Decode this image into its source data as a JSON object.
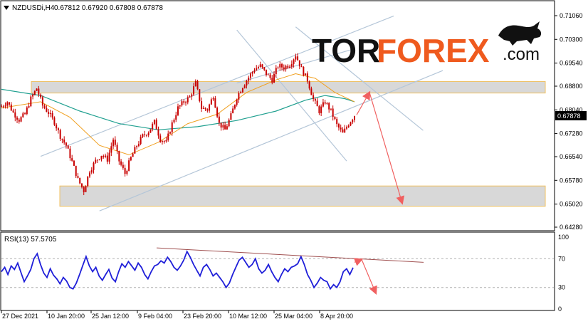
{
  "header": {
    "symbol": "NZDUSDi,H4",
    "ohlc": "0.67812 0.67920 0.67808 0.67878"
  },
  "price_badge": "0.67878",
  "logo": {
    "part1": "TOR",
    "part2": "FOREX",
    "part3": ".com"
  },
  "rsi": {
    "label": "RSI(13) 57.5705"
  },
  "colors": {
    "candles": "#c80000",
    "ma_fast": "#f0a020",
    "ma_slow": "#20a090",
    "trend_lines": "#b4c6d8",
    "rsi_line": "#1f1fd9",
    "rsi_trend": "#a05050",
    "arrows": "#f06060",
    "zone_fill": "#d8d8d8",
    "zone_border": "#f0c060",
    "logo_accent": "#ef5a1e"
  },
  "chart_data": [
    {
      "type": "candlestick",
      "title": "NZDUSDi,H4",
      "y_ticks": [
        "0.71060",
        "0.70300",
        "0.69540",
        "0.68800",
        "0.68040",
        "0.67280",
        "0.66540",
        "0.65780",
        "0.65020",
        "0.64280"
      ],
      "x_ticks": [
        "27 Dec 2021",
        "10 Jan 20:00",
        "25 Jan 12:00",
        "9 Feb 04:00",
        "23 Feb 20:00",
        "10 Mar 12:00",
        "25 Mar 04:00",
        "8 Apr 20:00"
      ],
      "ylim": [
        0.6428,
        0.7106
      ],
      "last_price": 0.67878,
      "close_path": [
        [
          0,
          0.6815
        ],
        [
          3,
          0.683
        ],
        [
          6,
          0.6795
        ],
        [
          9,
          0.6772
        ],
        [
          12,
          0.679
        ],
        [
          15,
          0.684
        ],
        [
          18,
          0.6873
        ],
        [
          21,
          0.6818
        ],
        [
          24,
          0.6795
        ],
        [
          27,
          0.6765
        ],
        [
          30,
          0.672
        ],
        [
          33,
          0.669
        ],
        [
          36,
          0.6638
        ],
        [
          39,
          0.658
        ],
        [
          42,
          0.6545
        ],
        [
          45,
          0.661
        ],
        [
          48,
          0.664
        ],
        [
          51,
          0.666
        ],
        [
          54,
          0.6645
        ],
        [
          57,
          0.671
        ],
        [
          60,
          0.664
        ],
        [
          63,
          0.66
        ],
        [
          66,
          0.665
        ],
        [
          69,
          0.669
        ],
        [
          72,
          0.672
        ],
        [
          75,
          0.6735
        ],
        [
          78,
          0.6765
        ],
        [
          81,
          0.671
        ],
        [
          84,
          0.67
        ],
        [
          87,
          0.676
        ],
        [
          90,
          0.681
        ],
        [
          93,
          0.683
        ],
        [
          96,
          0.6845
        ],
        [
          99,
          0.689
        ],
        [
          102,
          0.681
        ],
        [
          105,
          0.6805
        ],
        [
          108,
          0.685
        ],
        [
          111,
          0.676
        ],
        [
          114,
          0.674
        ],
        [
          117,
          0.6785
        ],
        [
          120,
          0.6845
        ],
        [
          123,
          0.688
        ],
        [
          126,
          0.6908
        ],
        [
          129,
          0.6935
        ],
        [
          132,
          0.6945
        ],
        [
          135,
          0.692
        ],
        [
          138,
          0.69
        ],
        [
          141,
          0.6945
        ],
        [
          144,
          0.694
        ],
        [
          147,
          0.695
        ],
        [
          150,
          0.698
        ],
        [
          153,
          0.6935
        ],
        [
          156,
          0.69
        ],
        [
          159,
          0.6838
        ],
        [
          162,
          0.68
        ],
        [
          165,
          0.683
        ],
        [
          168,
          0.68
        ],
        [
          171,
          0.6755
        ],
        [
          174,
          0.6728
        ],
        [
          177,
          0.676
        ],
        [
          180,
          0.6787
        ]
      ],
      "ma_fast": [
        [
          0,
          0.681
        ],
        [
          20,
          0.683
        ],
        [
          35,
          0.678
        ],
        [
          50,
          0.669
        ],
        [
          65,
          0.666
        ],
        [
          80,
          0.67
        ],
        [
          95,
          0.676
        ],
        [
          110,
          0.679
        ],
        [
          125,
          0.686
        ],
        [
          140,
          0.69
        ],
        [
          150,
          0.692
        ],
        [
          160,
          0.6905
        ],
        [
          170,
          0.686
        ],
        [
          180,
          0.683
        ]
      ],
      "ma_slow": [
        [
          0,
          0.687
        ],
        [
          20,
          0.685
        ],
        [
          40,
          0.68
        ],
        [
          60,
          0.676
        ],
        [
          80,
          0.674
        ],
        [
          100,
          0.675
        ],
        [
          120,
          0.677
        ],
        [
          140,
          0.68
        ],
        [
          155,
          0.6835
        ],
        [
          165,
          0.685
        ],
        [
          175,
          0.684
        ],
        [
          180,
          0.683
        ]
      ],
      "resistance_zone": [
        0.6858,
        0.6895
      ],
      "support_zone": [
        0.6495,
        0.656
      ],
      "forecast_path": [
        [
          180,
          0.67878
        ],
        [
          188,
          0.686
        ],
        [
          200,
          0.6505
        ]
      ]
    },
    {
      "type": "line",
      "title": "RSI(13) 57.5705",
      "y_ticks": [
        "100",
        "70",
        "30",
        "0"
      ],
      "levels": [
        70,
        30
      ],
      "ylim": [
        0,
        100
      ],
      "values": [
        52,
        58,
        48,
        60,
        55,
        64,
        51,
        38,
        46,
        55,
        70,
        77,
        62,
        50,
        44,
        56,
        47,
        42,
        35,
        44,
        39,
        30,
        28,
        36,
        48,
        61,
        73,
        60,
        52,
        58,
        46,
        40,
        48,
        55,
        43,
        38,
        52,
        63,
        58,
        66,
        60,
        54,
        64,
        58,
        48,
        42,
        52,
        60,
        62,
        67,
        64,
        72,
        66,
        58,
        54,
        60,
        68,
        80,
        72,
        62,
        54,
        46,
        58,
        62,
        55,
        46,
        50,
        44,
        38,
        30,
        36,
        48,
        58,
        68,
        72,
        65,
        58,
        62,
        70,
        56,
        50,
        54,
        62,
        52,
        44,
        38,
        48,
        56,
        52,
        58,
        60,
        63,
        73,
        62,
        48,
        40,
        30,
        36,
        44,
        40,
        38,
        28,
        34,
        30,
        38,
        52,
        56,
        48,
        57.5
      ],
      "trendline": [
        [
          220,
          85
        ],
        [
          595,
          65
        ]
      ]
    }
  ]
}
